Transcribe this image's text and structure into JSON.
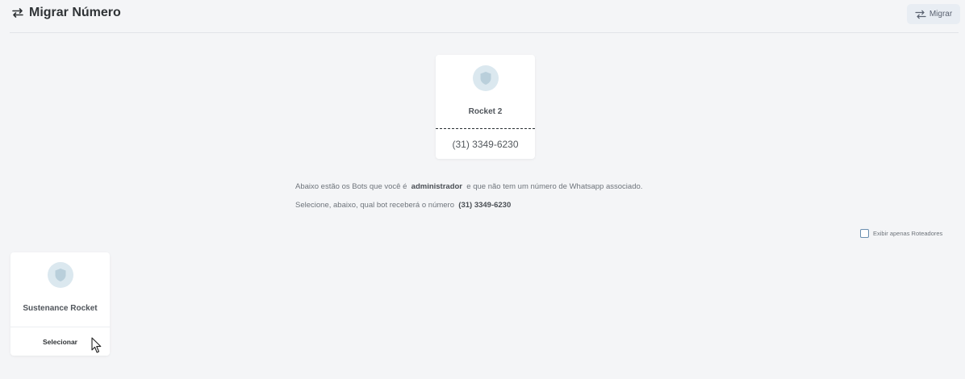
{
  "header": {
    "title": "Migrar Número",
    "title_icon": "swap-arrows-icon",
    "migrate_button_label": "Migrar",
    "migrate_button_icon": "swap-arrows-icon"
  },
  "source_bot": {
    "name": "Rocket 2",
    "phone": "(31) 3349-6230",
    "avatar_icon": "shield-icon"
  },
  "info": {
    "line1_before": "Abaixo estão os Bots que você é",
    "line1_role": "administrador",
    "line1_after": "e que não tem um número de Whatsapp associado.",
    "line2_before": "Selecione, abaixo, qual bot receberá o número",
    "line2_phone": "(31) 3349-6230"
  },
  "filter": {
    "label": "Exibir apenas Roteadores",
    "checked": false
  },
  "target_bots": [
    {
      "name": "Sustenance Rocket",
      "select_label": "Selecionar",
      "avatar_icon": "shield-icon"
    }
  ],
  "colors": {
    "background": "#f4f5f7",
    "card": "#ffffff",
    "avatar_bg": "#dbe8ef",
    "avatar_icon": "#b9cfdb",
    "button_bg": "#e8edf3"
  }
}
